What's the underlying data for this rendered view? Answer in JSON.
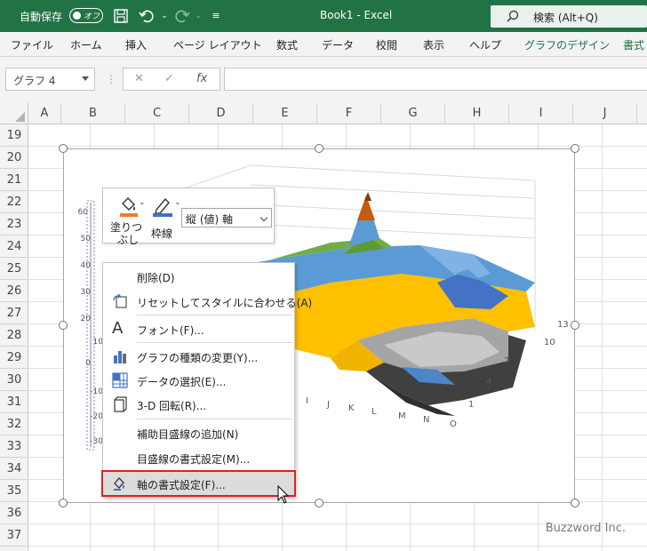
{
  "titlebar": {
    "autosave_label": "自動保存",
    "autosave_state": "オフ",
    "document_title": "Book1  -  Excel",
    "search_label": "検索 (Alt+Q)",
    "accent_color": "#217346"
  },
  "ribbon": {
    "tabs": [
      "ファイル",
      "ホーム",
      "挿入",
      "ページ レイアウト",
      "数式",
      "データ",
      "校閲",
      "表示",
      "ヘルプ",
      "グラフのデザイン",
      "書式"
    ]
  },
  "formula_bar": {
    "name_box": "グラフ 4",
    "fx_label": "fx",
    "value": ""
  },
  "grid": {
    "columns": [
      "A",
      "B",
      "C",
      "D",
      "E",
      "F",
      "G",
      "H",
      "I",
      "J"
    ],
    "rows": [
      "19",
      "20",
      "21",
      "22",
      "23",
      "24",
      "25",
      "26",
      "27",
      "28",
      "29",
      "30",
      "31",
      "32",
      "33",
      "34",
      "35",
      "36",
      "37"
    ]
  },
  "chart": {
    "type": "3d-surface",
    "axis_labels_visible": [
      "60",
      "50",
      "40",
      "30",
      "20",
      "10",
      "0",
      "-10",
      "-20",
      "-30"
    ],
    "x_axis_ticks": [
      "I",
      "J",
      "K",
      "L",
      "M",
      "N",
      "O"
    ],
    "depth_axis_ticks": [
      "13",
      "10",
      "7",
      "4",
      "1"
    ]
  },
  "mini_toolbar": {
    "fill_label_line1": "塗りつ",
    "fill_label_line2": "ぶし",
    "outline_label": "枠線",
    "element_selector": "縦 (値) 軸",
    "fill_color": "#ed7d31",
    "outline_color": "#4472c4"
  },
  "context_menu": {
    "items": [
      {
        "label": "削除(D)",
        "icon": "delete"
      },
      {
        "label": "リセットしてスタイルに合わせる(A)",
        "icon": "reset-style-icon"
      },
      {
        "label": "フォント(F)...",
        "icon": "font-icon"
      },
      {
        "label": "グラフの種類の変更(Y)...",
        "icon": "chart-type-icon"
      },
      {
        "label": "データの選択(E)...",
        "icon": "select-data-icon"
      },
      {
        "label": "3-D 回転(R)...",
        "icon": "rotate-3d-icon"
      },
      {
        "label": "補助目盛線の追加(N)",
        "icon": ""
      },
      {
        "label": "目盛線の書式設定(M)...",
        "icon": ""
      },
      {
        "label": "軸の書式設定(F)...",
        "icon": "format-axis-icon"
      }
    ],
    "highlighted_index": 8
  },
  "watermark": "Buzzword Inc."
}
